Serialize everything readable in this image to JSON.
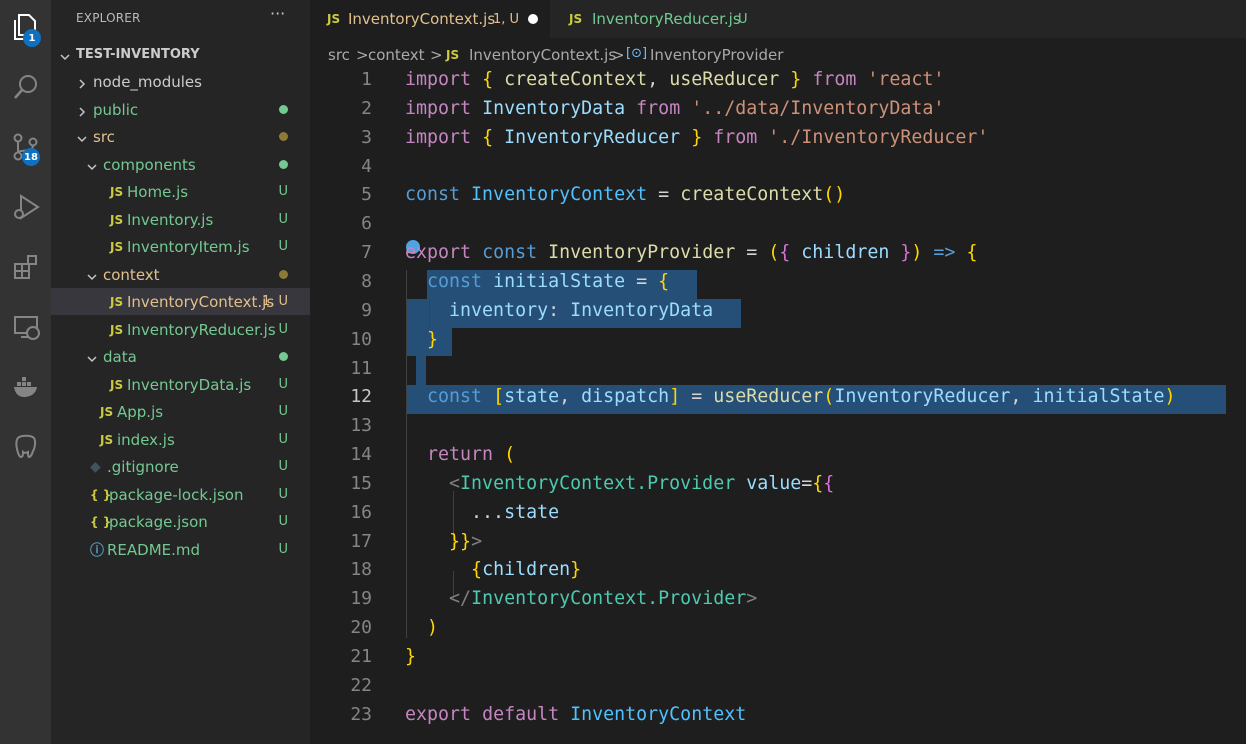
{
  "activity_bar": {
    "explorer_badge": "1",
    "source_control_badge": "18",
    "icons": [
      "files-icon",
      "search-icon",
      "source-control-icon",
      "run-debug-icon",
      "extensions-icon",
      "remote-explorer-icon",
      "docker-icon",
      "database-icon"
    ]
  },
  "sidebar": {
    "title": "EXPLORER",
    "more": "···",
    "root": "TEST-INVENTORY",
    "items": [
      {
        "label": "node_modules",
        "status": "",
        "dot": ""
      },
      {
        "label": "public",
        "status": "",
        "dot": "#73c991"
      },
      {
        "label": "src",
        "status": "",
        "dot": "#8d7a34"
      },
      {
        "label": "components",
        "status": "",
        "dot": "#73c991"
      },
      {
        "label": "Home.js",
        "status": "U",
        "dot": ""
      },
      {
        "label": "Inventory.js",
        "status": "U",
        "dot": ""
      },
      {
        "label": "InventoryItem.js",
        "status": "U",
        "dot": ""
      },
      {
        "label": "context",
        "status": "",
        "dot": "#8d7a34"
      },
      {
        "label": "InventoryContext.js",
        "status": "1, U",
        "dot": ""
      },
      {
        "label": "InventoryReducer.js",
        "status": "U",
        "dot": ""
      },
      {
        "label": "data",
        "status": "",
        "dot": "#73c991"
      },
      {
        "label": "InventoryData.js",
        "status": "U",
        "dot": ""
      },
      {
        "label": "App.js",
        "status": "U",
        "dot": ""
      },
      {
        "label": "index.js",
        "status": "U",
        "dot": ""
      },
      {
        "label": ".gitignore",
        "status": "U",
        "dot": ""
      },
      {
        "label": "package-lock.json",
        "status": "U",
        "dot": ""
      },
      {
        "label": "package.json",
        "status": "U",
        "dot": ""
      },
      {
        "label": "README.md",
        "status": "U",
        "dot": ""
      }
    ]
  },
  "tabs": [
    {
      "icon": "JS",
      "label": "InventoryContext.js",
      "status": "1, U",
      "active": true,
      "modified": true
    },
    {
      "icon": "JS",
      "label": "InventoryReducer.js",
      "status": "U",
      "active": false,
      "modified": false
    }
  ],
  "breadcrumb": {
    "parts": [
      "src",
      "context",
      "InventoryContext.js",
      "InventoryProvider"
    ],
    "separator": ">",
    "js_icon": "JS"
  },
  "editor": {
    "current_line": 12,
    "line_numbers": [
      "1",
      "2",
      "3",
      "4",
      "5",
      "6",
      "7",
      "8",
      "9",
      "10",
      "11",
      "12",
      "13",
      "14",
      "15",
      "16",
      "17",
      "18",
      "19",
      "20",
      "21",
      "22",
      "23"
    ],
    "lines": [
      "import { createContext, useReducer } from 'react'",
      "import InventoryData from '../data/InventoryData'",
      "import { InventoryReducer } from './InventoryReducer'",
      "",
      "const InventoryContext = createContext()",
      "",
      "export const InventoryProvider = ({ children }) => {",
      "  const initialState = {",
      "    inventory: InventoryData",
      "  }",
      "",
      "  const [state, dispatch] = useReducer(InventoryReducer, initialState)",
      "",
      "  return (",
      "    <InventoryContext.Provider value={{",
      "      ...state",
      "    }}>",
      "      {children}",
      "    </InventoryContext.Provider>",
      "  )",
      "}",
      "",
      "export default InventoryContext"
    ]
  },
  "colors": {
    "keyword_control": "#c586c0",
    "keyword": "#569cd6",
    "function": "#dcdcaa",
    "variable": "#9cdcfe",
    "string": "#ce9178",
    "component": "#4ec9b0",
    "selection": "#264f78",
    "git_untracked": "#73c991",
    "git_modified": "#e2c08d"
  }
}
